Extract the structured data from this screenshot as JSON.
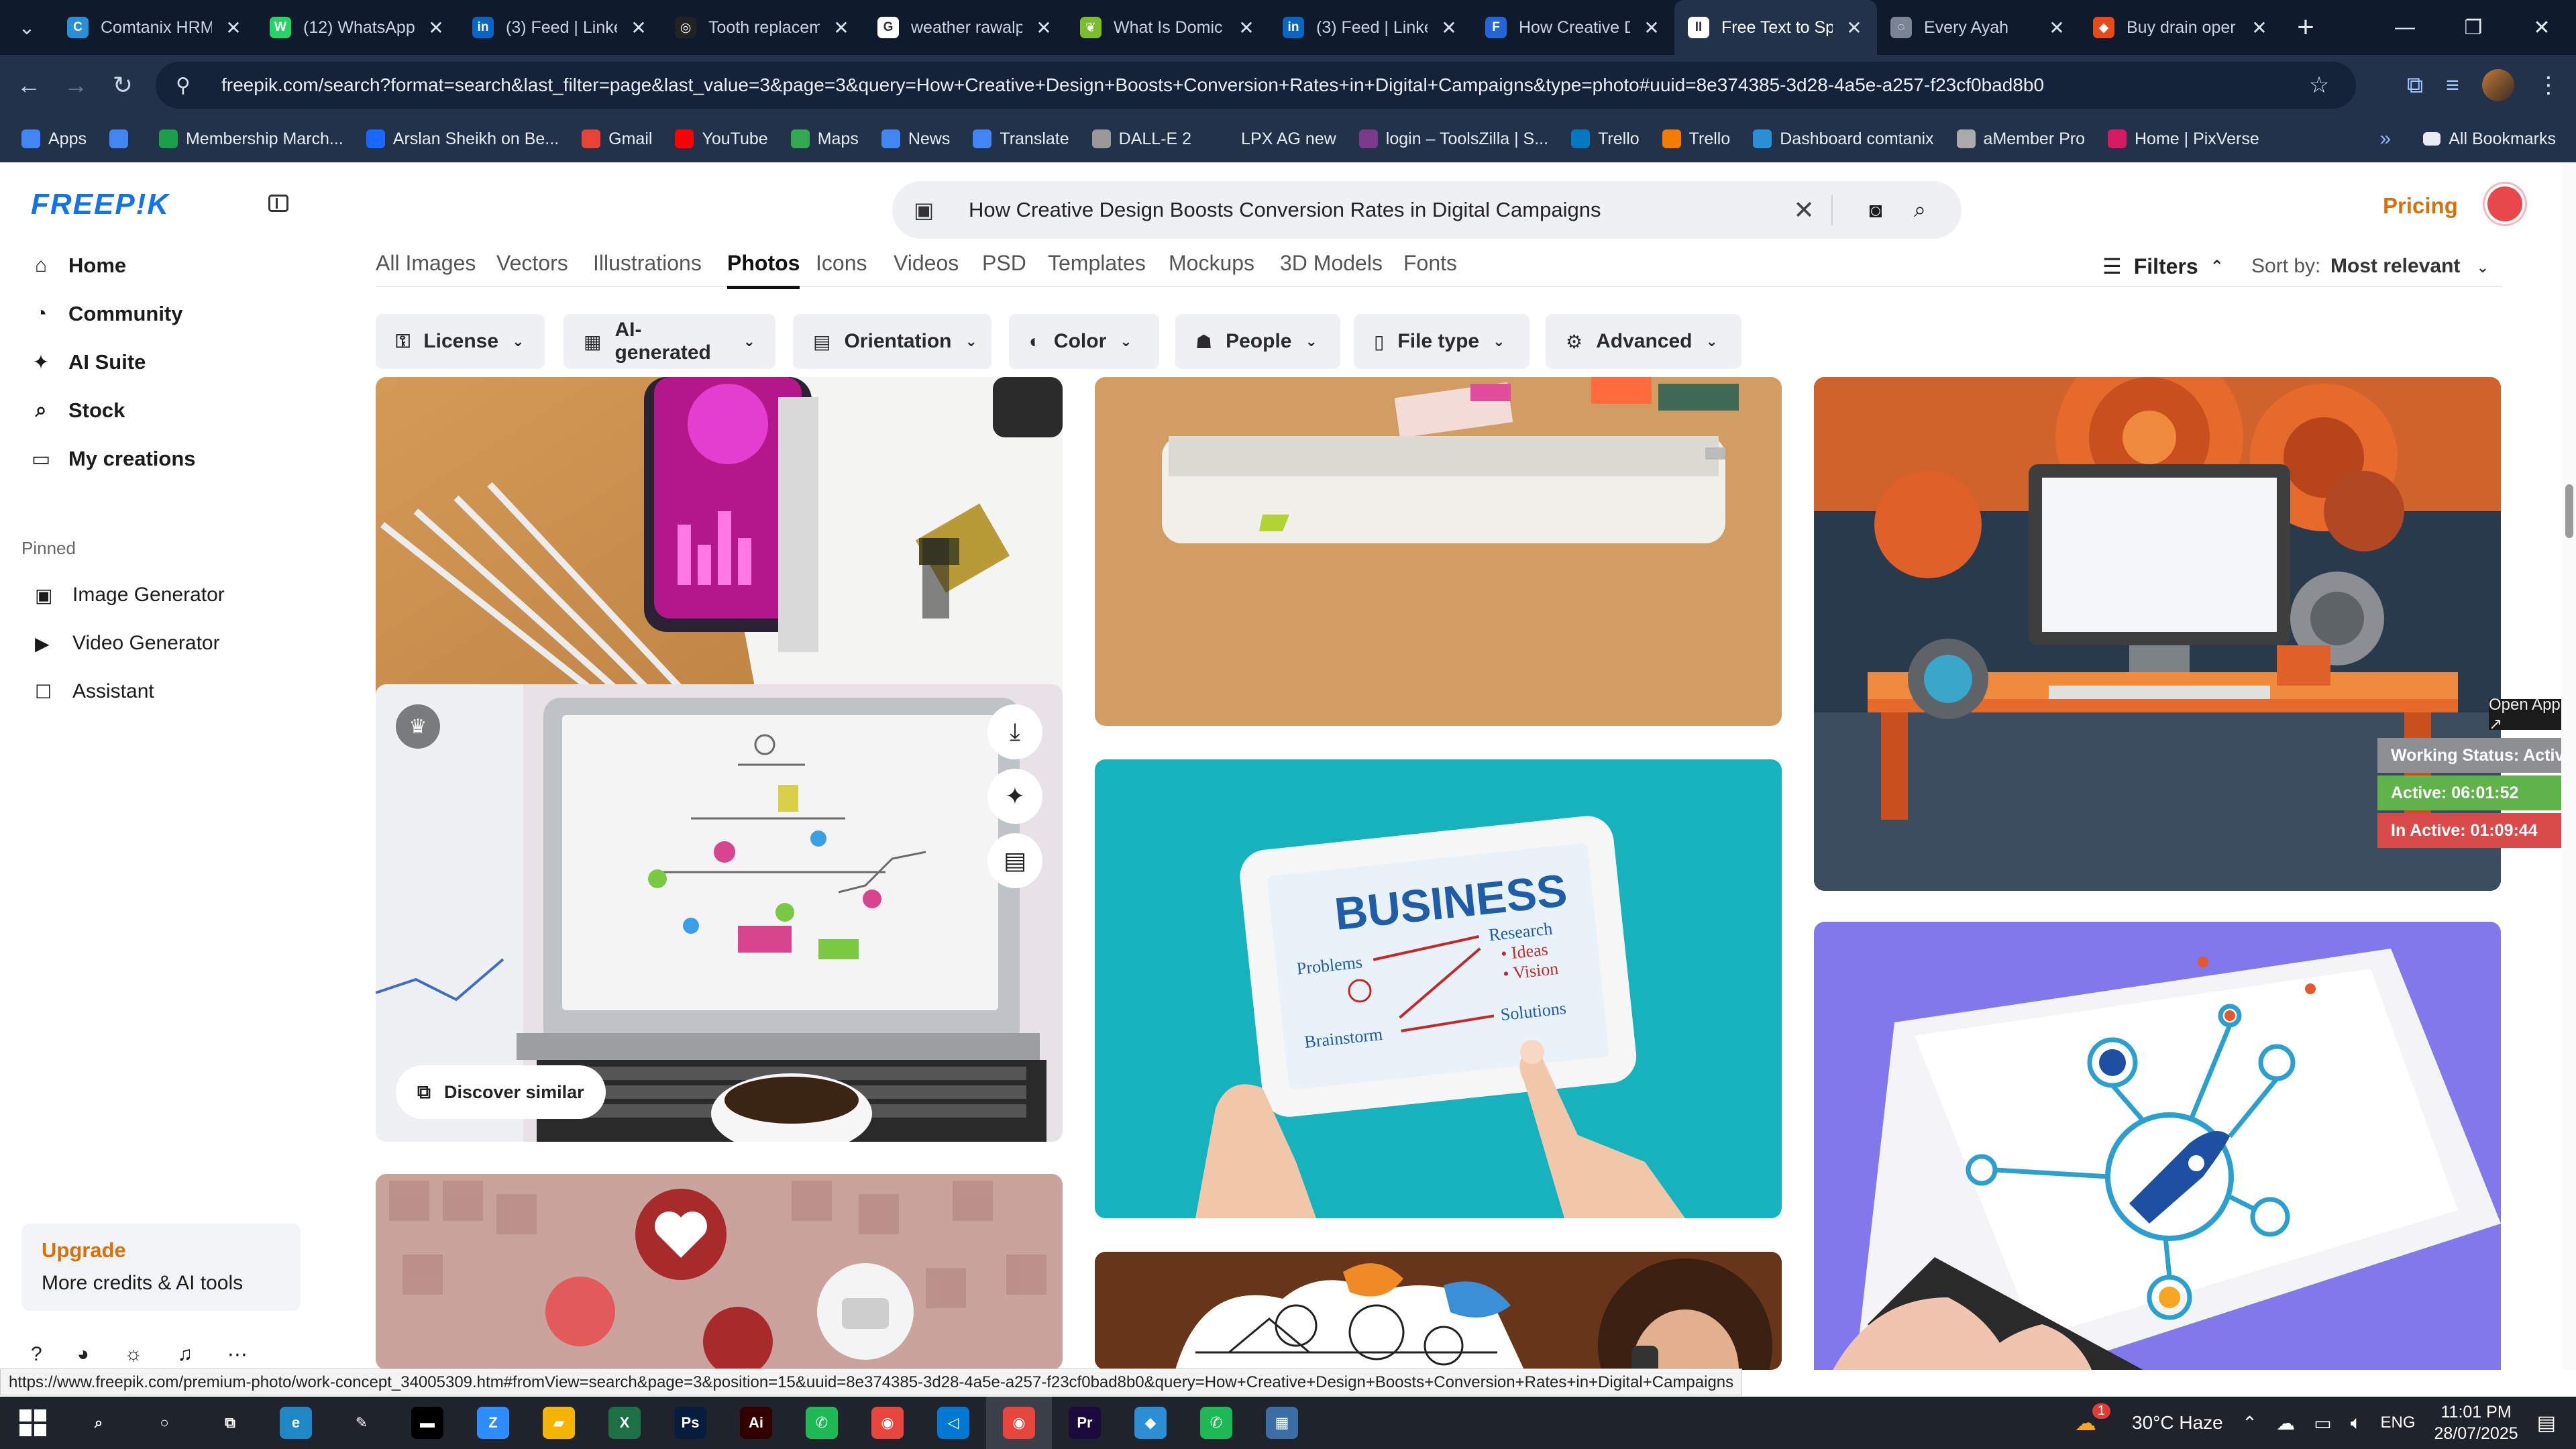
{
  "browser": {
    "tabs": [
      {
        "title": "Comtanix HRM",
        "color": "#2a8fd6",
        "glyph": "C"
      },
      {
        "title": "(12) WhatsApp",
        "color": "#25d366",
        "glyph": "W"
      },
      {
        "title": "(3) Feed | Linke",
        "color": "#0a66c2",
        "glyph": "in"
      },
      {
        "title": "Tooth replacem",
        "color": "#222222",
        "glyph": "◎"
      },
      {
        "title": "weather rawalp",
        "color": "#ffffff",
        "glyph": "G"
      },
      {
        "title": "What Is Domic",
        "color": "#7cbc2f",
        "glyph": "❦"
      },
      {
        "title": "(3) Feed | Linke",
        "color": "#0a66c2",
        "glyph": "in"
      },
      {
        "title": "How Creative D",
        "color": "#2466d6",
        "glyph": "F"
      },
      {
        "title": "Free Text to Sp",
        "color": "#ffffff",
        "glyph": "II"
      },
      {
        "title": "Every Ayah",
        "color": "#7a8494",
        "glyph": "◌"
      },
      {
        "title": "Buy drain oper",
        "color": "#e64a19",
        "glyph": "◆"
      }
    ],
    "active_tab_index": 8,
    "url": "freepik.com/search?format=search&last_filter=page&last_value=3&page=3&query=How+Creative+Design+Boosts+Conversion+Rates+in+Digital+Campaigns&type=photo#uuid=8e374385-3d28-4a5e-a257-f23cf0bad8b0",
    "bookmarks": [
      {
        "label": "Apps",
        "color": "#4285f4"
      },
      {
        "label": "",
        "color": "#4285f4"
      },
      {
        "label": "Membership March...",
        "color": "#1d9e4a"
      },
      {
        "label": "Arslan Sheikh on Be...",
        "color": "#1769ff"
      },
      {
        "label": "Gmail",
        "color": "#ea4335"
      },
      {
        "label": "YouTube",
        "color": "#ff0000"
      },
      {
        "label": "Maps",
        "color": "#34a853"
      },
      {
        "label": "News",
        "color": "#4285f4"
      },
      {
        "label": "Translate",
        "color": "#4285f4"
      },
      {
        "label": "DALL-E 2",
        "color": "#999999"
      },
      {
        "label": "LPX AG new",
        "color": "#22324b"
      },
      {
        "label": "login – ToolsZilla | S...",
        "color": "#7d3a8c"
      },
      {
        "label": "Trello",
        "color": "#0079bf"
      },
      {
        "label": "Trello",
        "color": "#f57c00"
      },
      {
        "label": "Dashboard comtanix",
        "color": "#2a8fd6"
      },
      {
        "label": "aMember Pro",
        "color": "#aaaaaa"
      },
      {
        "label": "Home | PixVerse",
        "color": "#d81b60"
      }
    ],
    "all_bookmarks": "All Bookmarks"
  },
  "freepik": {
    "logo": "FREEP!K",
    "nav": [
      {
        "label": "Home",
        "icon": "⌂"
      },
      {
        "label": "Community",
        "icon": "◔"
      },
      {
        "label": "AI Suite",
        "icon": "✦"
      },
      {
        "label": "Stock",
        "icon": "⌕"
      },
      {
        "label": "My creations",
        "icon": "▭"
      }
    ],
    "pinned_label": "Pinned",
    "pinned": [
      {
        "label": "Image Generator",
        "icon": "▣"
      },
      {
        "label": "Video Generator",
        "icon": "▶"
      },
      {
        "label": "Assistant",
        "icon": "☐"
      }
    ],
    "upgrade": {
      "title": "Upgrade",
      "subtitle": "More credits & AI tools"
    },
    "search_query": "How Creative Design Boosts Conversion Rates in Digital Campaigns",
    "pricing": "Pricing",
    "categories": [
      "All Images",
      "Vectors",
      "Illustrations",
      "Photos",
      "Icons",
      "Videos",
      "PSD",
      "Templates",
      "Mockups",
      "3D Models",
      "Fonts"
    ],
    "active_category": "Photos",
    "filters_label": "Filters",
    "sort_label": "Sort by:",
    "sort_value": "Most relevant",
    "chips": [
      {
        "label": "License",
        "icon": "⚿"
      },
      {
        "label": "AI-generated",
        "icon": "▦"
      },
      {
        "label": "Orientation",
        "icon": "▤"
      },
      {
        "label": "Color",
        "icon": "◐"
      },
      {
        "label": "People",
        "icon": "☗"
      },
      {
        "label": "File type",
        "icon": "▯"
      },
      {
        "label": "Advanced",
        "icon": "⚙"
      }
    ],
    "discover_similar": "Discover similar",
    "image_texts": {
      "business_title": "BUSINESS",
      "business_words": [
        "Problems",
        "Research",
        "• Ideas",
        "• Vision",
        "Brainstorm",
        "Solutions"
      ]
    }
  },
  "overlay_widget": {
    "open_app": "Open App ↗",
    "status": "Working Status: Active",
    "active": "Active: 06:01:52",
    "inactive": "In Active: 01:09:44"
  },
  "status_url": "https://www.freepik.com/premium-photo/work-concept_34005309.htm#fromView=search&page=3&position=15&uuid=8e374385-3d28-4a5e-a257-f23cf0bad8b0&query=How+Creative+Design+Boosts+Conversion+Rates+in+Digital+Campaigns",
  "taskbar": {
    "apps": [
      {
        "name": "search",
        "label": "⌕",
        "color": "#1f232b"
      },
      {
        "name": "cortana",
        "label": "○",
        "color": "#1f232b"
      },
      {
        "name": "task-view",
        "label": "⧉",
        "color": "#1f232b"
      },
      {
        "name": "edge",
        "label": "e",
        "color": "#1e88c7"
      },
      {
        "name": "pen",
        "label": "✎",
        "color": "#1f232b"
      },
      {
        "name": "terminal",
        "label": "▬",
        "color": "#000000"
      },
      {
        "name": "zoom",
        "label": "Z",
        "color": "#2d8cff"
      },
      {
        "name": "explorer",
        "label": "▰",
        "color": "#f4b400"
      },
      {
        "name": "excel",
        "label": "X",
        "color": "#1d7044"
      },
      {
        "name": "photoshop",
        "label": "Ps",
        "color": "#061e3c"
      },
      {
        "name": "illustrator",
        "label": "Ai",
        "color": "#330000"
      },
      {
        "name": "phone",
        "label": "✆",
        "color": "#1db954"
      },
      {
        "name": "chrome",
        "label": "◉",
        "color": "#e8453c"
      },
      {
        "name": "vscode",
        "label": "◁",
        "color": "#0078d4"
      },
      {
        "name": "chrome-active",
        "label": "◉",
        "color": "#e8453c"
      },
      {
        "name": "premiere",
        "label": "Pr",
        "color": "#1c0a3c"
      },
      {
        "name": "app-x",
        "label": "◆",
        "color": "#2a8fd6"
      },
      {
        "name": "phone2",
        "label": "✆",
        "color": "#1db954"
      },
      {
        "name": "calculator",
        "label": "▦",
        "color": "#3a6ea5"
      }
    ],
    "weather": "30°C  Haze",
    "notif_count": "1",
    "lang": "ENG",
    "time": "11:01 PM",
    "date": "28/07/2025"
  }
}
